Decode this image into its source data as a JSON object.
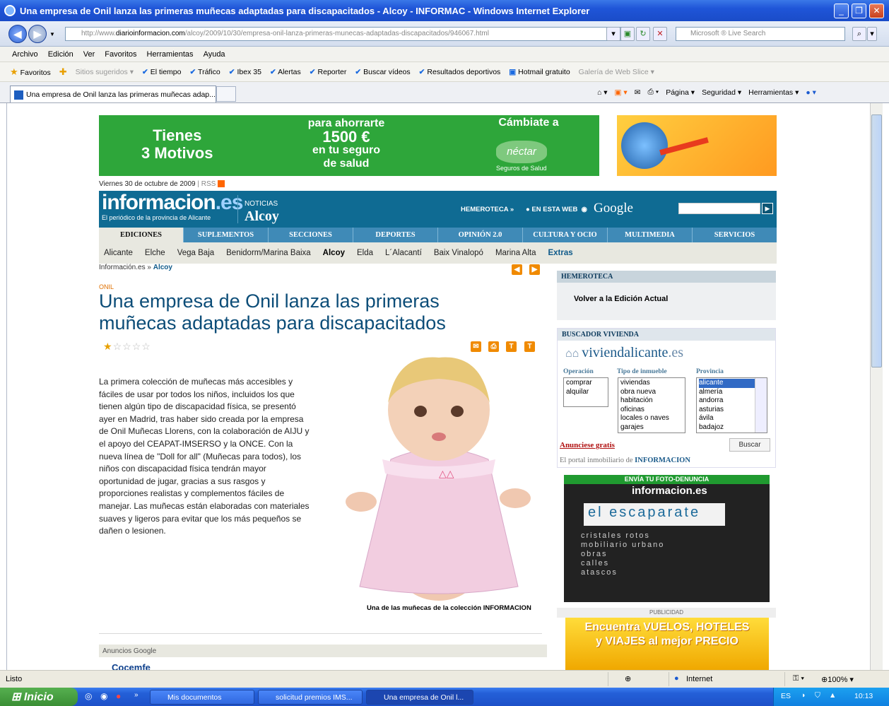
{
  "window": {
    "title": "Una empresa de Onil lanza las primeras muñecas adaptadas para discapacitados - Alcoy - INFORMAC - Windows Internet Explorer"
  },
  "address": {
    "prefix": "http://www.",
    "domain": "diarioinformacion.com",
    "path": "/alcoy/2009/10/30/empresa-onil-lanza-primeras-munecas-adaptadas-discapacitados/946067.html",
    "search_placeholder": "Microsoft ® Live Search"
  },
  "menu": [
    "Archivo",
    "Edición",
    "Ver",
    "Favoritos",
    "Herramientas",
    "Ayuda"
  ],
  "favorites": {
    "label": "Favoritos",
    "items": [
      "Sitios sugeridos ▾",
      "El tiempo",
      "Tráfico",
      "Ibex 35",
      "Alertas",
      "Reporter",
      "Buscar vídeos",
      "Resultados deportivos",
      "Hotmail gratuito",
      "Galería de Web Slice ▾"
    ]
  },
  "tab": {
    "title": "Una empresa de Onil lanza las primeras muñecas adap..."
  },
  "command_bar": [
    "Página ▾",
    "Seguridad ▾",
    "Herramientas ▾"
  ],
  "ad": {
    "left": "Tienes\n3 Motivos",
    "mid_top": "para ahorrarte",
    "mid_amount": "1500 €",
    "mid_bottom": "en tu seguro\nde salud",
    "right_top": "Cámbiate a",
    "brand": "néctar",
    "brand_sub": "Seguros de Salud"
  },
  "date": "Viernes 30 de octubre de 2009",
  "rss": "RSS",
  "header": {
    "logo": "informacion",
    "logo_ext": ".es",
    "tagline": "El periódico de la provincia de Alicante",
    "noticias": "NOTICIAS",
    "city": "Alcoy",
    "hemeroteca": "HEMEROTECA »",
    "en_esta_web": "EN ESTA WEB",
    "google": "Google"
  },
  "sections": [
    "EDICIONES",
    "SUPLEMENTOS",
    "SECCIONES",
    "DEPORTES",
    "OPINIÓN 2.0",
    "CULTURA Y OCIO",
    "MULTIMEDIA",
    "SERVICIOS"
  ],
  "editions": [
    "Alicante",
    "Elche",
    "Vega Baja",
    "Benidorm/Marina Baixa",
    "Alcoy",
    "Elda",
    "L´Alacantí",
    "Baix Vinalopó",
    "Marina Alta",
    "Extras"
  ],
  "breadcrumb": {
    "root": "Información.es",
    "sep": "»",
    "current": "Alcoy"
  },
  "article": {
    "kicker": "ONIL",
    "headline": "Una empresa de Onil lanza las primeras muñecas adaptadas para discapacitados",
    "rating": 1,
    "rating_max": 5,
    "body": "La primera colección de muñecas más accesibles y fáciles de usar por todos los niños, incluidos los que tienen algún tipo de discapacidad física, se presentó ayer en Madrid, tras haber sido creada por la empresa de Onil Muñecas Llorens, con la colaboración de AIJU y el apoyo del CEAPAT-IMSERSO y la ONCE. Con la nueva línea de \"Doll for all\" (Muñecas para todos), los niños con discapacidad física tendrán mayor oportunidad de jugar, gracias a sus rasgos y proporciones realistas y complementos fáciles de manejar. Las muñecas están elaboradas con materiales suaves y ligeros para evitar que los más pequeños se dañen o lesionen.",
    "caption": "Una de las muñecas de la colección INFORMACION"
  },
  "google_ads": {
    "label": "Anuncios Google",
    "first": "Cocemfe"
  },
  "sidebar": {
    "hemeroteca_title": "HEMEROTECA",
    "hemeroteca_link": "Volver a la Edición Actual",
    "buscador_title": "BUSCADOR VIVIENDA",
    "viv_logo": "viviendalicante",
    "viv_ext": ".es",
    "op_label": "Operación",
    "tipo_label": "Tipo de inmueble",
    "prov_label": "Provincia",
    "operaciones": [
      "comprar",
      "alquilar"
    ],
    "tipos": [
      "viviendas",
      "obra nueva",
      "habitación",
      "oficinas",
      "locales o naves",
      "garajes"
    ],
    "provincias": [
      "alicante",
      "almería",
      "andorra",
      "asturias",
      "ávila",
      "badajoz"
    ],
    "anuncie": "Anunciese gratis",
    "buscar": "Buscar",
    "portal": "El portal inmobiliario de",
    "portal_brand": "INFORMACION",
    "foto_title": "ENVÍA TU FOTO-DENUNCIA",
    "foto_logo": "informacion.es",
    "foto_banner": "el escaparate",
    "foto_lines": "cristales rotos\nmobiliario urbano\nobras\ncalles\natascos",
    "publicidad": "PUBLICIDAD",
    "adv": "Encuentra VUELOS, HOTELES\ny VIAJES al mejor PRECIO"
  },
  "status": {
    "text": "Listo",
    "zone": "Internet",
    "zoom": "100%"
  },
  "taskbar": {
    "start": "Inicio",
    "buttons": [
      "Mis documentos",
      "solicitud premios IMS...",
      "Una empresa de Onil l..."
    ],
    "lang": "ES",
    "clock": "10:13"
  }
}
